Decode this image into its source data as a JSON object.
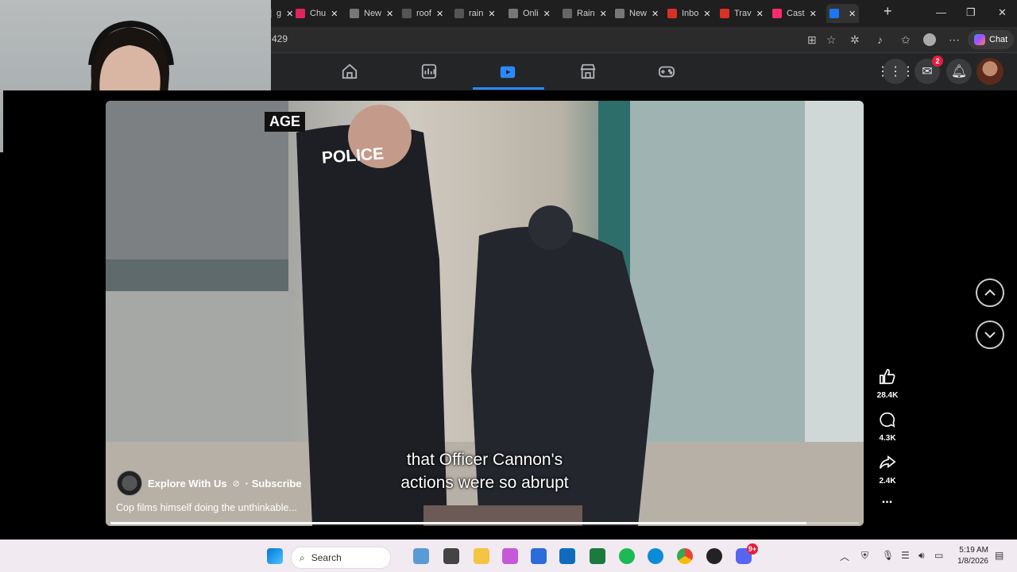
{
  "browser": {
    "tabs": [
      {
        "label": "g",
        "color": "#555"
      },
      {
        "label": "Chu",
        "color": "#e0245e"
      },
      {
        "label": "New",
        "color": "#777"
      },
      {
        "label": "roof",
        "color": "#555"
      },
      {
        "label": "rain",
        "color": "#555"
      },
      {
        "label": "Onli",
        "color": "#777"
      },
      {
        "label": "Rain",
        "color": "#666"
      },
      {
        "label": "New",
        "color": "#777"
      },
      {
        "label": "Inbo",
        "color": "#d93025"
      },
      {
        "label": "Trav",
        "color": "#d93025"
      },
      {
        "label": "Cast",
        "color": "#ff2a6d"
      },
      {
        "label": "",
        "color": "#1877f2"
      }
    ],
    "url_fragment": "429",
    "chat_label": "Chat"
  },
  "facebook": {
    "notifications_badge": "2",
    "nav_active": "video"
  },
  "video": {
    "footage_label": "AGE",
    "caption_line1": "that Officer Cannon's",
    "caption_line2": "actions were so abrupt",
    "channel_name": "Explore With Us",
    "verified_glyph": "⊘",
    "subscribe_label": "· Subscribe",
    "description": "Cop films himself doing the unthinkable...",
    "progress": 0.93,
    "police_text": "POLICE"
  },
  "actions": {
    "likes": "28.4K",
    "comments": "4.3K",
    "shares": "2.4K",
    "more": "•••"
  },
  "taskbar": {
    "search_label": "Search",
    "time": "5:19 AM",
    "date": "1/8/2026",
    "notif_badge": "9+"
  }
}
